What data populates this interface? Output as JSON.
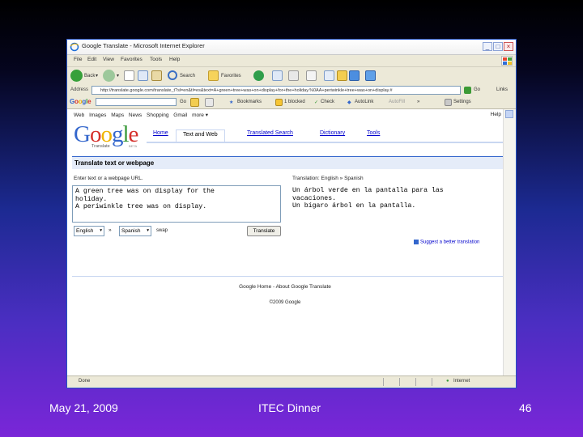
{
  "browser": {
    "title": "Google Translate - Microsoft Internet Explorer",
    "menu": [
      "File",
      "Edit",
      "View",
      "Favorites",
      "Tools",
      "Help"
    ],
    "nav": {
      "back": "Back",
      "search": "Search",
      "favorites": "Favorites"
    },
    "address": {
      "label": "Address",
      "url": "http://translate.google.com/translate_t?sl=en&tl=es&text=A+green+tree+was+on+display+for+the+holiday.%0AA+periwinkle+tree+was+on+display.#",
      "go": "Go",
      "links": "Links"
    },
    "google_toolbar": {
      "logo": "Google",
      "go": "Go",
      "bookmarks": "Bookmarks",
      "blocked": "1 blocked",
      "check": "Check",
      "autolink": "AutoLink",
      "autofill": "AutoFill",
      "more": "»",
      "settings": "Settings"
    },
    "status": {
      "left": "Done",
      "zone": "Internet"
    }
  },
  "page": {
    "top_links": [
      "Web",
      "Images",
      "Maps",
      "News",
      "Shopping",
      "Gmail",
      "more ▾"
    ],
    "help": "Help",
    "logo_sub": "Translate",
    "logo_beta": "BETA",
    "tabs": [
      "Home",
      "Text and Web",
      "Translated Search",
      "Dictionary",
      "Tools"
    ],
    "active_tab": 1,
    "section_title": "Translate text or webpage",
    "source_label": "Enter text or a webpage URL.",
    "source_text": "A green tree was on display for the\nholiday.\nA periwinkle tree was on display.",
    "translation_label": "Translation: English » Spanish",
    "translation_text": "Un árbol verde en la pantalla para las\nvacaciones.\nUn bígaro árbol en la pantalla.",
    "from_lang": "English",
    "swap": "»",
    "to_lang": "Spanish",
    "swap_label": "swap",
    "translate_button": "Translate",
    "suggest": "Suggest a better translation",
    "footer_links": "Google Home - About Google Translate",
    "copyright": "©2009 Google"
  },
  "slide": {
    "date": "May 21, 2009",
    "event": "ITEC Dinner",
    "page_number": "46"
  },
  "colors": {
    "link": "#0000cc",
    "section_bg": "#e5ecf9",
    "google_blue": "#3366cc"
  }
}
